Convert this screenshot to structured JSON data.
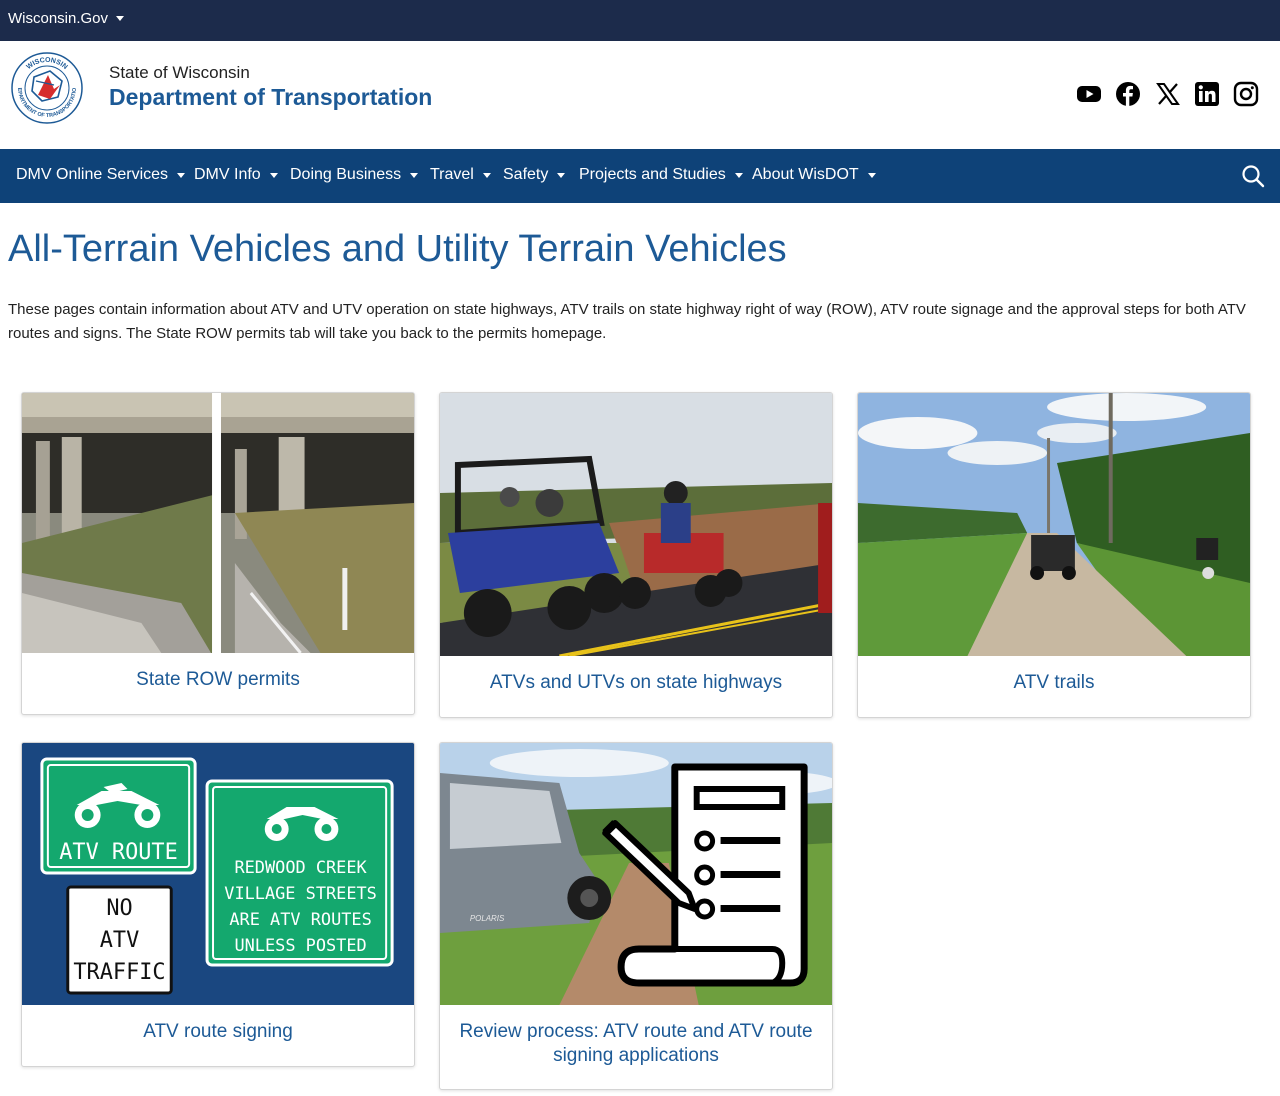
{
  "topbar": {
    "gov_label": "Wisconsin.Gov"
  },
  "header": {
    "state_label": "State of Wisconsin",
    "department": "Department of Transportation",
    "logo_text_top": "WISCONSIN",
    "logo_text_bottom": "DEPARTMENT OF TRANSPORTATION",
    "social_icons": [
      "youtube-icon",
      "facebook-icon",
      "x-icon",
      "linkedin-icon",
      "instagram-icon"
    ]
  },
  "nav": {
    "items": [
      {
        "label": "DMV Online Services"
      },
      {
        "label": "DMV Info"
      },
      {
        "label": "Doing Business"
      },
      {
        "label": "Travel"
      },
      {
        "label": "Safety"
      },
      {
        "label": "Projects and Studies"
      },
      {
        "label": "About WisDOT"
      }
    ],
    "search_icon": "search-icon"
  },
  "main": {
    "title": "All-Terrain Vehicles and Utility Terrain Vehicles",
    "intro": "These pages contain information about ATV and UTV operation on state highways, ATV trails on state highway right of way (ROW), ATV route signage and the approval steps for both ATV routes and signs. The State ROW permits tab will take you back to the permits homepage.",
    "cards": [
      {
        "label": "State ROW permits"
      },
      {
        "label": "ATVs and UTVs on state highways"
      },
      {
        "label": "ATV trails"
      },
      {
        "label": "ATV route signing"
      },
      {
        "label": "Review process: ATV route and ATV route signing applications"
      }
    ],
    "signs": {
      "atv_route": "ATV ROUTE",
      "no_atv": [
        "NO",
        "ATV",
        "TRAFFIC"
      ],
      "redwood": [
        "REDWOOD CREEK",
        "VILLAGE STREETS",
        "ARE ATV ROUTES",
        "UNLESS POSTED"
      ]
    },
    "photo_text": {
      "vehicle_brand": "POLARIS"
    }
  },
  "colors": {
    "topbar": "#1c2b4b",
    "nav": "#0e4278",
    "brand_blue": "#1d5a96",
    "sign_green": "#14a86e",
    "sign_panel": "#1a4780"
  }
}
